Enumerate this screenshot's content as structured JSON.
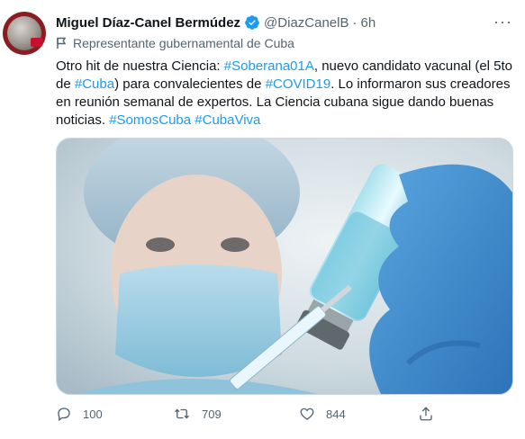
{
  "tweet": {
    "author_name": "Miguel Díaz-Canel Bermúdez",
    "handle": "@DiazCanelB",
    "separator": "·",
    "time": "6h",
    "more_label": "···",
    "label": "Representante gubernamental de Cuba",
    "text_parts": [
      {
        "text": "Otro hit de nuestra Ciencia: ",
        "tag": false
      },
      {
        "text": "#Soberana01A",
        "tag": true
      },
      {
        "text": ", nuevo candidato vacunal (el 5to de ",
        "tag": false
      },
      {
        "text": "#Cuba",
        "tag": true
      },
      {
        "text": ") para convalecientes de ",
        "tag": false
      },
      {
        "text": "#COVID19",
        "tag": true
      },
      {
        "text": ". Lo informaron sus creadores en reunión semanal de expertos. La Ciencia cubana sigue dando buenas noticias. ",
        "tag": false
      },
      {
        "text": "#SomosCuba",
        "tag": true
      },
      {
        "text": " ",
        "tag": false
      },
      {
        "text": "#CubaViva",
        "tag": true
      }
    ]
  },
  "actions": {
    "replies": "100",
    "retweets": "709",
    "likes": "844"
  },
  "icons": {
    "verified": "verified-badge-icon",
    "label": "flag-icon",
    "reply": "reply-icon",
    "retweet": "retweet-icon",
    "like": "heart-icon",
    "share": "share-icon"
  },
  "colors": {
    "link": "#1d9bf0",
    "secondary": "#536471",
    "text": "#0f1419"
  }
}
